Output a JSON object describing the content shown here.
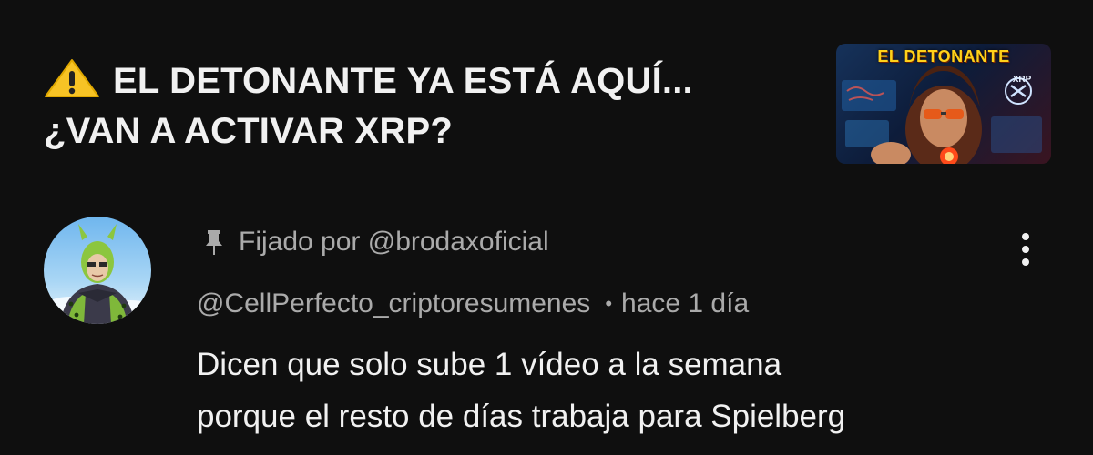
{
  "video": {
    "title_line1": "EL DETONANTE YA ESTÁ AQUÍ...",
    "title_line2": "¿VAN A ACTIVAR XRP?",
    "warning_icon": "warning-triangle-icon",
    "thumbnail": {
      "title": "EL DETONANTE",
      "logo_text": "XRP"
    }
  },
  "comment": {
    "pinned_label": "Fijado por @brodaxoficial",
    "pin_icon": "pin-icon",
    "author_handle": "@CellPerfecto_criptoresumenes",
    "separator": "•",
    "time": "hace 1 día",
    "body_line1": "Dicen que solo sube 1 vídeo a la semana",
    "body_line2": "porque el resto de días trabaja para Spielberg",
    "more_icon": "more-vertical-icon"
  },
  "colors": {
    "background": "#0f0f0f",
    "primary_text": "#f1f1f1",
    "secondary_text": "#aaaaaa",
    "warning_yellow": "#f7c325",
    "thumbnail_accent": "#ffd21a"
  }
}
